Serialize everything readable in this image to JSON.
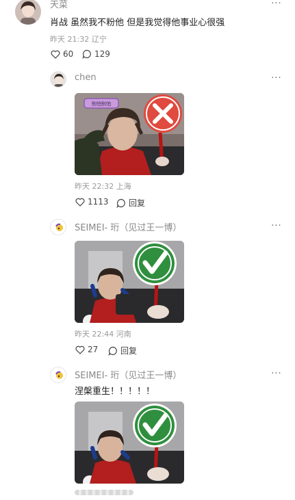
{
  "top_comment": {
    "username": "天菜",
    "text": "肖战  虽然我不粉他  但是我觉得他事业心很强",
    "meta": "昨天 21:32 辽宁",
    "likes": "60",
    "replies": "129"
  },
  "replies": [
    {
      "username": "chen",
      "meta": "昨天 22:32 上海",
      "likes": "1113",
      "reply_label": "回复",
      "sticker_text": "别怕别怕"
    },
    {
      "username": "SEIMEI- 珩（见过王一博）",
      "meta": "昨天 22:44 河南",
      "likes": "27",
      "reply_label": "回复"
    },
    {
      "username": "SEIMEI- 珩（见过王一博）",
      "text": "涅槃重生！！！！！"
    }
  ],
  "more_glyph": "···",
  "colors": {
    "red_sign": "#e04a3f",
    "green_sign": "#2f8f3e",
    "text_muted": "#999999"
  }
}
